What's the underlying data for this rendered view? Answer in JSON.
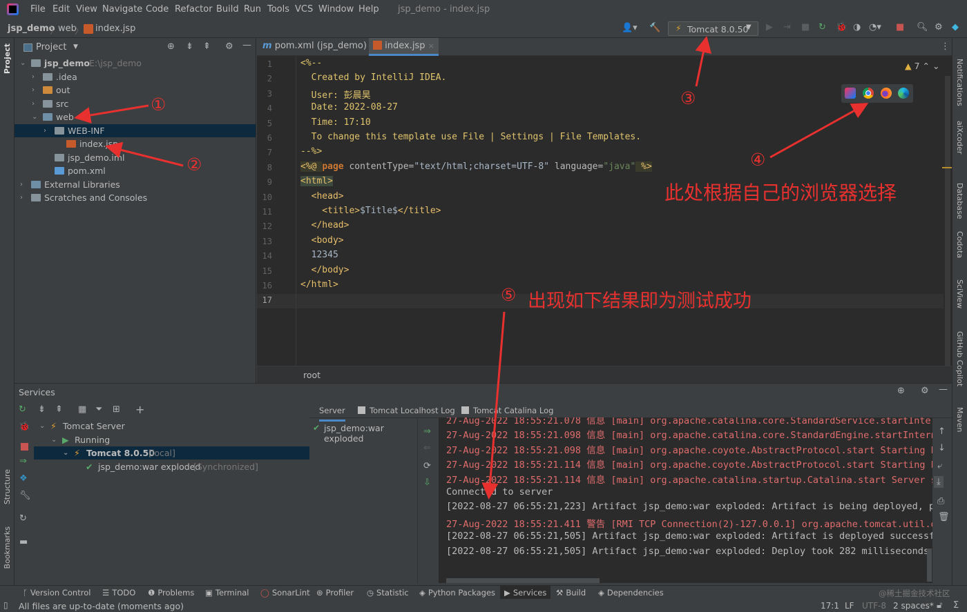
{
  "window": {
    "title": "jsp_demo - index.jsp",
    "menu": [
      "File",
      "Edit",
      "View",
      "Navigate",
      "Code",
      "Refactor",
      "Build",
      "Run",
      "Tools",
      "VCS",
      "Window",
      "Help"
    ]
  },
  "breadcrumb": [
    "jsp_demo",
    "web",
    "index.jsp"
  ],
  "toolbar": {
    "run_config": "Tomcat 8.0.50"
  },
  "left_strip": {
    "project": "Project",
    "structure": "Structure",
    "bookmarks": "Bookmarks"
  },
  "right_strip": [
    "Notifications",
    "aiXcoder",
    "Database",
    "Codota",
    "SciView",
    "GitHub Copilot",
    "Maven"
  ],
  "project_panel": {
    "title": "Project",
    "tree": [
      {
        "label": "jsp_demo",
        "extra": "E:\\jsp_demo",
        "indent": 0,
        "arrow": "open",
        "icon": "folder",
        "bold": true
      },
      {
        "label": ".idea",
        "indent": 1,
        "arrow": "closed",
        "icon": "folder"
      },
      {
        "label": "out",
        "indent": 1,
        "arrow": "closed",
        "icon": "folder-orange"
      },
      {
        "label": "src",
        "indent": 1,
        "arrow": "closed",
        "icon": "folder"
      },
      {
        "label": "web",
        "indent": 1,
        "arrow": "open",
        "icon": "folder-web"
      },
      {
        "label": "WEB-INF",
        "indent": 2,
        "arrow": "closed",
        "icon": "folder",
        "selected": true
      },
      {
        "label": "index.jsp",
        "indent": 3,
        "icon": "jsp"
      },
      {
        "label": "jsp_demo.iml",
        "indent": 2,
        "icon": "iml"
      },
      {
        "label": "pom.xml",
        "indent": 2,
        "icon": "maven"
      },
      {
        "label": "External Libraries",
        "indent": 0,
        "arrow": "closed",
        "icon": "library"
      },
      {
        "label": "Scratches and Consoles",
        "indent": 0,
        "arrow": "closed",
        "icon": "scratch"
      }
    ]
  },
  "editor": {
    "tabs": [
      {
        "label": "pom.xml (jsp_demo)",
        "active": false
      },
      {
        "label": "index.jsp",
        "active": true
      }
    ],
    "warnings": "7",
    "breadcrumb": "root",
    "current_line": 17,
    "lines": [
      [
        [
          "<%--",
          "comment"
        ]
      ],
      [
        [
          "  Created by IntelliJ IDEA.",
          "comment"
        ]
      ],
      [
        [
          "  User: 彭晨昊",
          "comment"
        ]
      ],
      [
        [
          "  Date: 2022-08-27",
          "comment"
        ]
      ],
      [
        [
          "  Time: 17:10",
          "comment"
        ]
      ],
      [
        [
          "  To change this template use File | Settings | File Templates.",
          "comment"
        ]
      ],
      [
        [
          "--%>",
          "comment"
        ]
      ],
      [
        [
          "<%@ ",
          "dir"
        ],
        [
          "page ",
          "kw"
        ],
        [
          "contentType=",
          "attr"
        ],
        [
          "\"text/html;charset=UTF-8\"",
          "text"
        ],
        [
          " language=",
          "attr"
        ],
        [
          "\"java\"",
          "str"
        ],
        [
          " %>",
          "dir"
        ]
      ],
      [
        [
          "<html>",
          "tagsel"
        ]
      ],
      [
        [
          "  <head>",
          "tag"
        ]
      ],
      [
        [
          "    <title>",
          "tag"
        ],
        [
          "$Title$",
          "text"
        ],
        [
          "</title>",
          "tag"
        ]
      ],
      [
        [
          "  </head>",
          "tag"
        ]
      ],
      [
        [
          "  <body>",
          "tag"
        ]
      ],
      [
        [
          "  12345",
          "text"
        ]
      ],
      [
        [
          "  </body>",
          "tag"
        ]
      ],
      [
        [
          "</html>",
          "tag"
        ]
      ],
      [
        [
          "",
          "text"
        ]
      ]
    ]
  },
  "services": {
    "title": "Services",
    "tree": [
      {
        "label": "Tomcat Server",
        "indent": 0
      },
      {
        "label": "Running",
        "indent": 1
      },
      {
        "label": "Tomcat 8.0.50",
        "extra": "[local]",
        "indent": 2,
        "selected": true
      },
      {
        "label": "jsp_demo:war exploded",
        "extra": "[Synchronized]",
        "indent": 3
      }
    ],
    "tabs": [
      "Server",
      "Tomcat Localhost Log",
      "Tomcat Catalina Log"
    ],
    "deployment": "jsp_demo:war exploded",
    "console": [
      {
        "text": "27-Aug-2022 18:55:21.078 信息 [main] org.apache.catalina.core.StandardService.startInternal",
        "level": "err"
      },
      {
        "text": "27-Aug-2022 18:55:21.098 信息 [main] org.apache.catalina.core.StandardEngine.startInternal S",
        "level": "err"
      },
      {
        "text": "27-Aug-2022 18:55:21.098 信息 [main] org.apache.coyote.AbstractProtocol.start Starting Proto",
        "level": "err"
      },
      {
        "text": "27-Aug-2022 18:55:21.114 信息 [main] org.apache.coyote.AbstractProtocol.start Starting Proto",
        "level": "err"
      },
      {
        "text": "27-Aug-2022 18:55:21.114 信息 [main] org.apache.catalina.startup.Catalina.start Server start",
        "level": "err"
      },
      {
        "text": "Connected to server",
        "level": "norm"
      },
      {
        "text": "[2022-08-27 06:55:21,223] Artifact jsp_demo:war exploded: Artifact is being deployed, pleas",
        "level": "norm"
      },
      {
        "text": "27-Aug-2022 18:55:21.411 警告 [RMI TCP Connection(2)-127.0.0.1] org.apache.tomcat.util.descr",
        "level": "err"
      },
      {
        "text": "[2022-08-27 06:55:21,505] Artifact jsp_demo:war exploded: Artifact is deployed successfully",
        "level": "norm"
      },
      {
        "text": "[2022-08-27 06:55:21,505] Artifact jsp_demo:war exploded: Deploy took 282 milliseconds",
        "level": "norm"
      }
    ]
  },
  "bottom_tools": [
    "Version Control",
    "TODO",
    "Problems",
    "Terminal",
    "SonarLint",
    "Profiler",
    "Statistic",
    "Python Packages",
    "Services",
    "Build",
    "Dependencies"
  ],
  "active_bottom_tool": "Services",
  "watermark": "@稀土掘金技术社区",
  "status": {
    "message": "All files are up-to-date (moments ago)",
    "position": "17:1",
    "line_sep": "LF",
    "encoding": "UTF-8",
    "indent": "2 spaces*"
  },
  "annotations": {
    "n1": "①",
    "n2": "②",
    "n3": "③",
    "n4": "④",
    "n5": "⑤",
    "note4": "此处根据自己的浏览器选择",
    "note5": "出现如下结果即为测试成功"
  },
  "colors": {
    "annotation": "#e8312f",
    "selection": "#0d293e",
    "error_text": "#e06c6c"
  }
}
